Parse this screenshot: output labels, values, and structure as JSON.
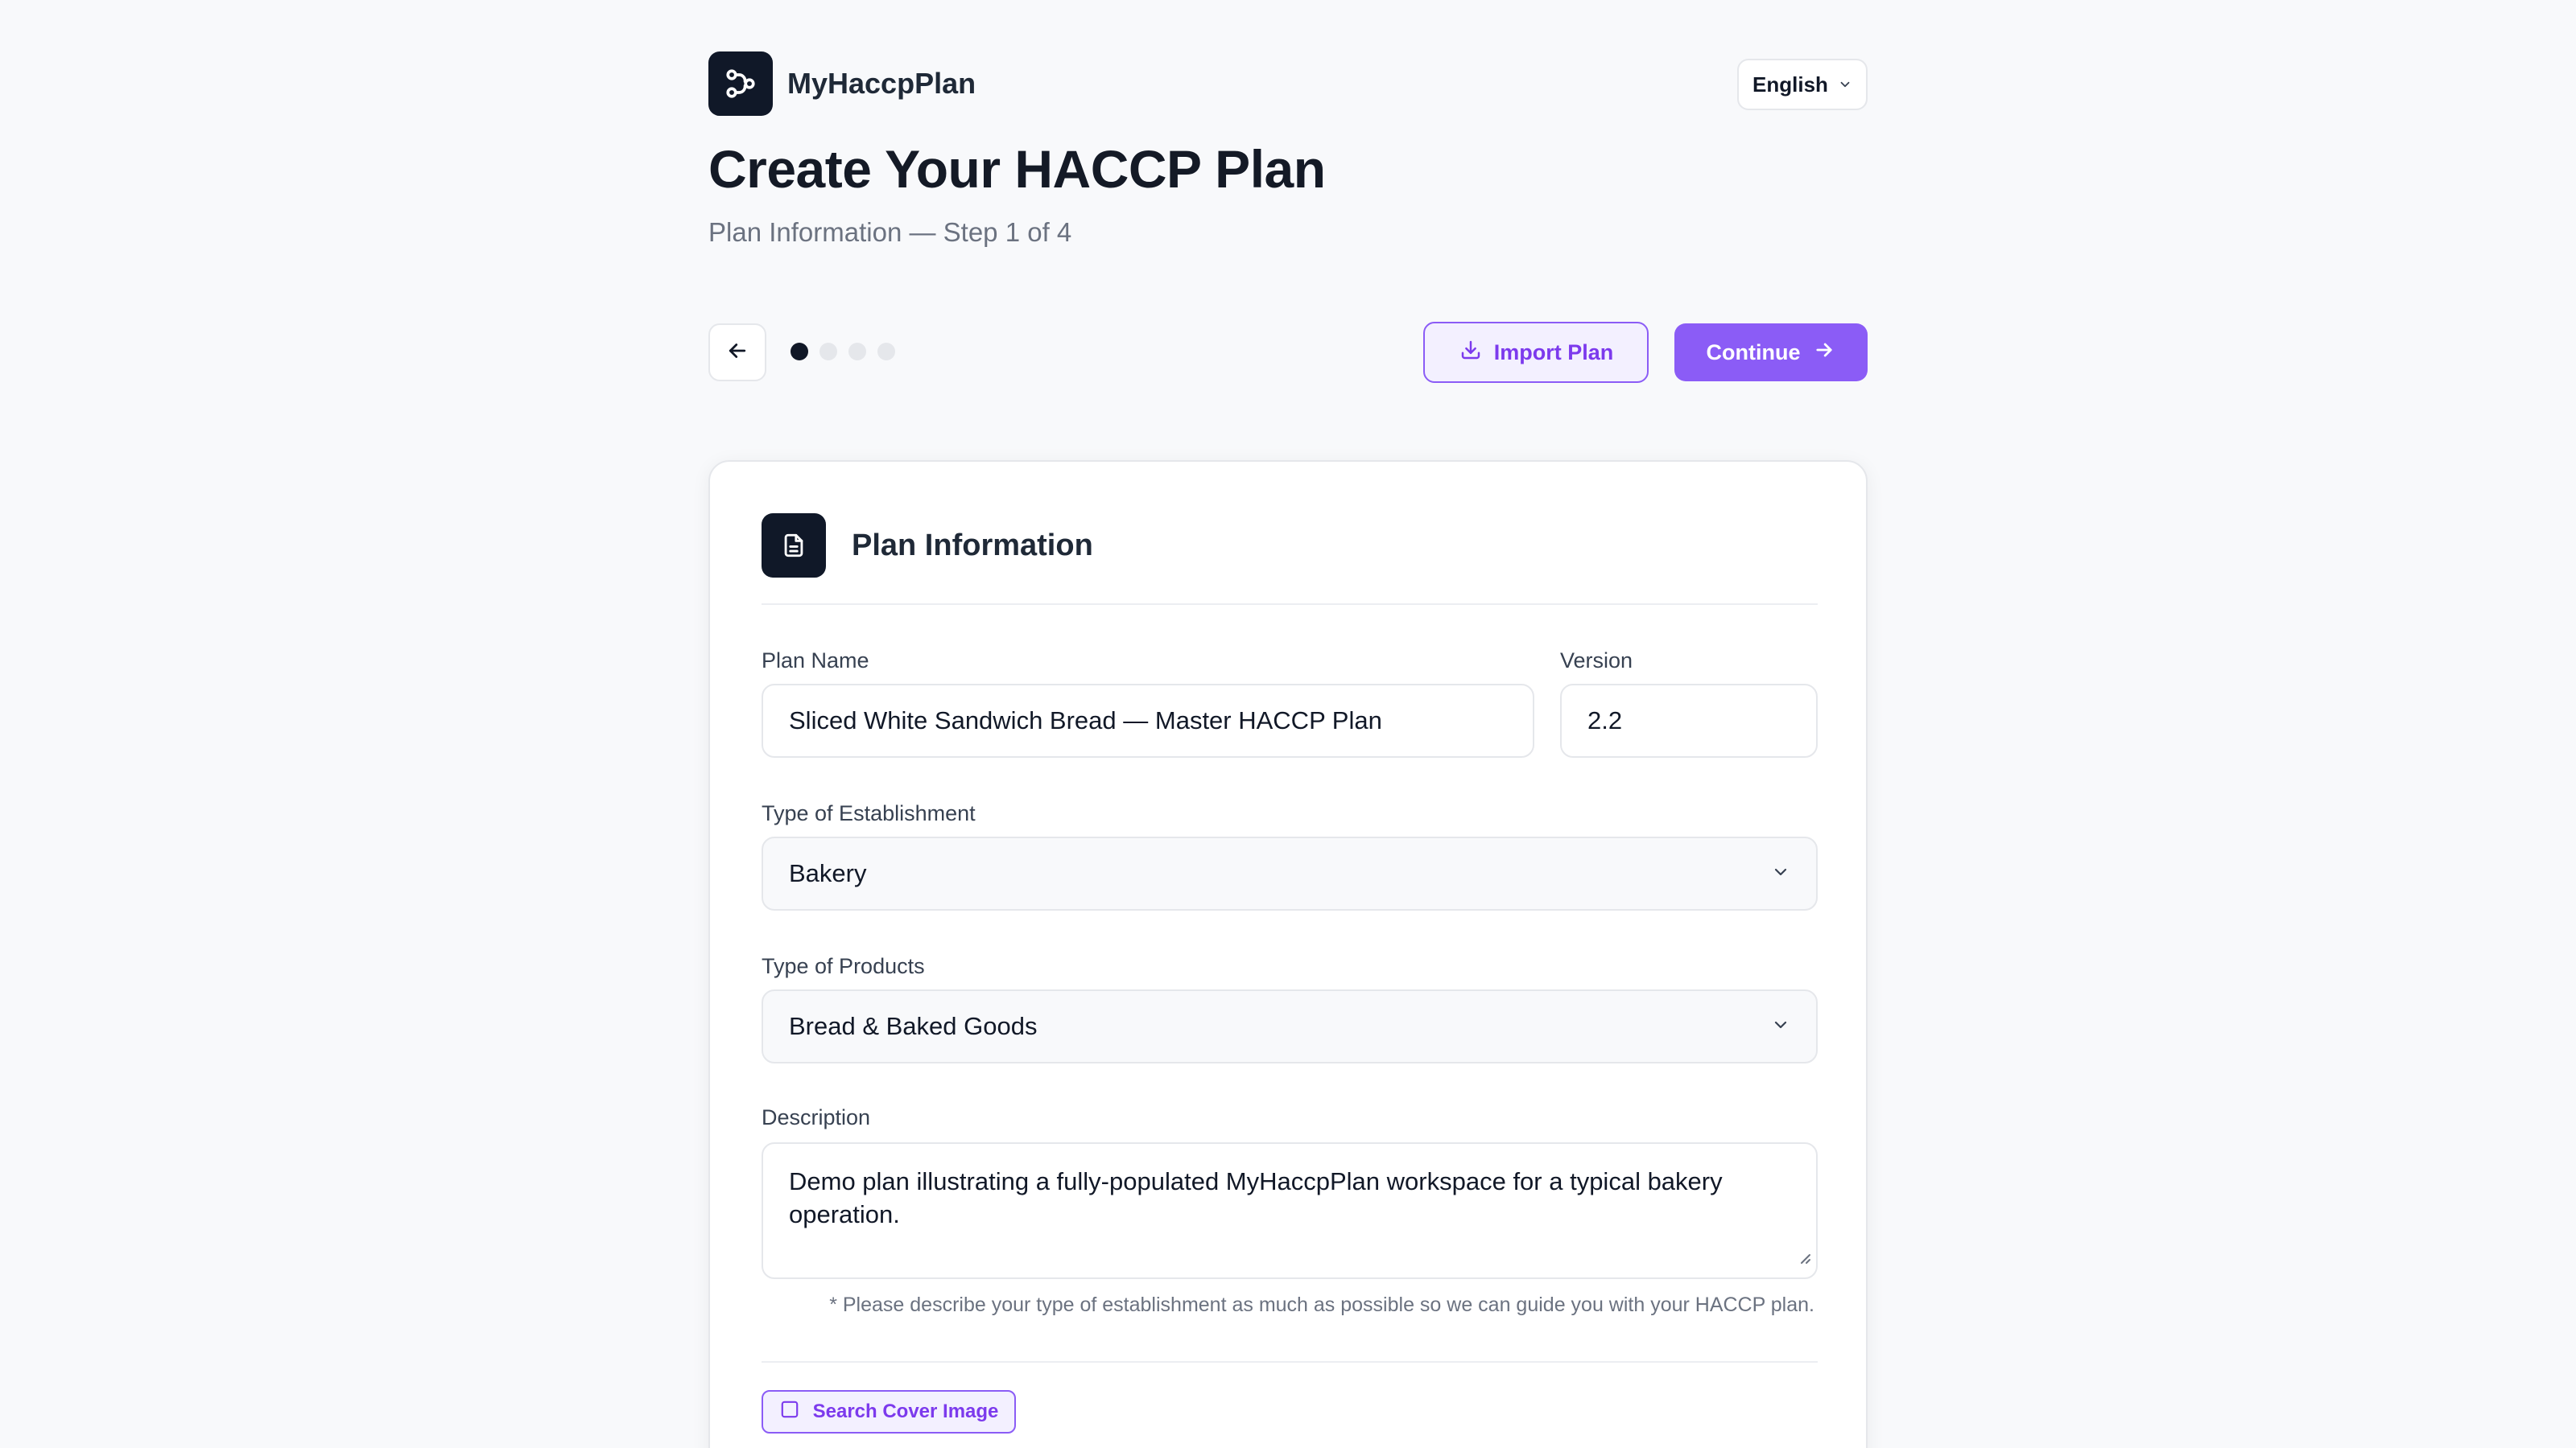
{
  "brand": {
    "name": "MyHaccpPlan",
    "logo_icon": "workflow-icon"
  },
  "language": {
    "selected": "English"
  },
  "page": {
    "title": "Create Your HACCP Plan",
    "subtitle": "Plan Information — Step 1 of 4"
  },
  "steps": {
    "current": 1,
    "total": 4
  },
  "actions": {
    "import_label": "Import Plan",
    "continue_label": "Continue"
  },
  "card": {
    "title": "Plan Information",
    "icon": "document-icon",
    "fields": {
      "plan_name": {
        "label": "Plan Name",
        "value": "Sliced White Sandwich Bread — Master HACCP Plan"
      },
      "version": {
        "label": "Version",
        "value": "2.2"
      },
      "establishment": {
        "label": "Type of Establishment",
        "value": "Bakery"
      },
      "products": {
        "label": "Type of Products",
        "value": "Bread & Baked Goods"
      },
      "description": {
        "label": "Description",
        "value": "Demo plan illustrating a fully-populated MyHaccpPlan workspace for a typical bakery operation."
      }
    },
    "hint": "* Please describe your type of establishment as much as possible so we can guide you with your HACCP plan.",
    "cover_label": "Search Cover Image"
  },
  "colors": {
    "accent": "#8b5cf6",
    "accent_text": "#7c3aed",
    "dark": "#101828"
  }
}
